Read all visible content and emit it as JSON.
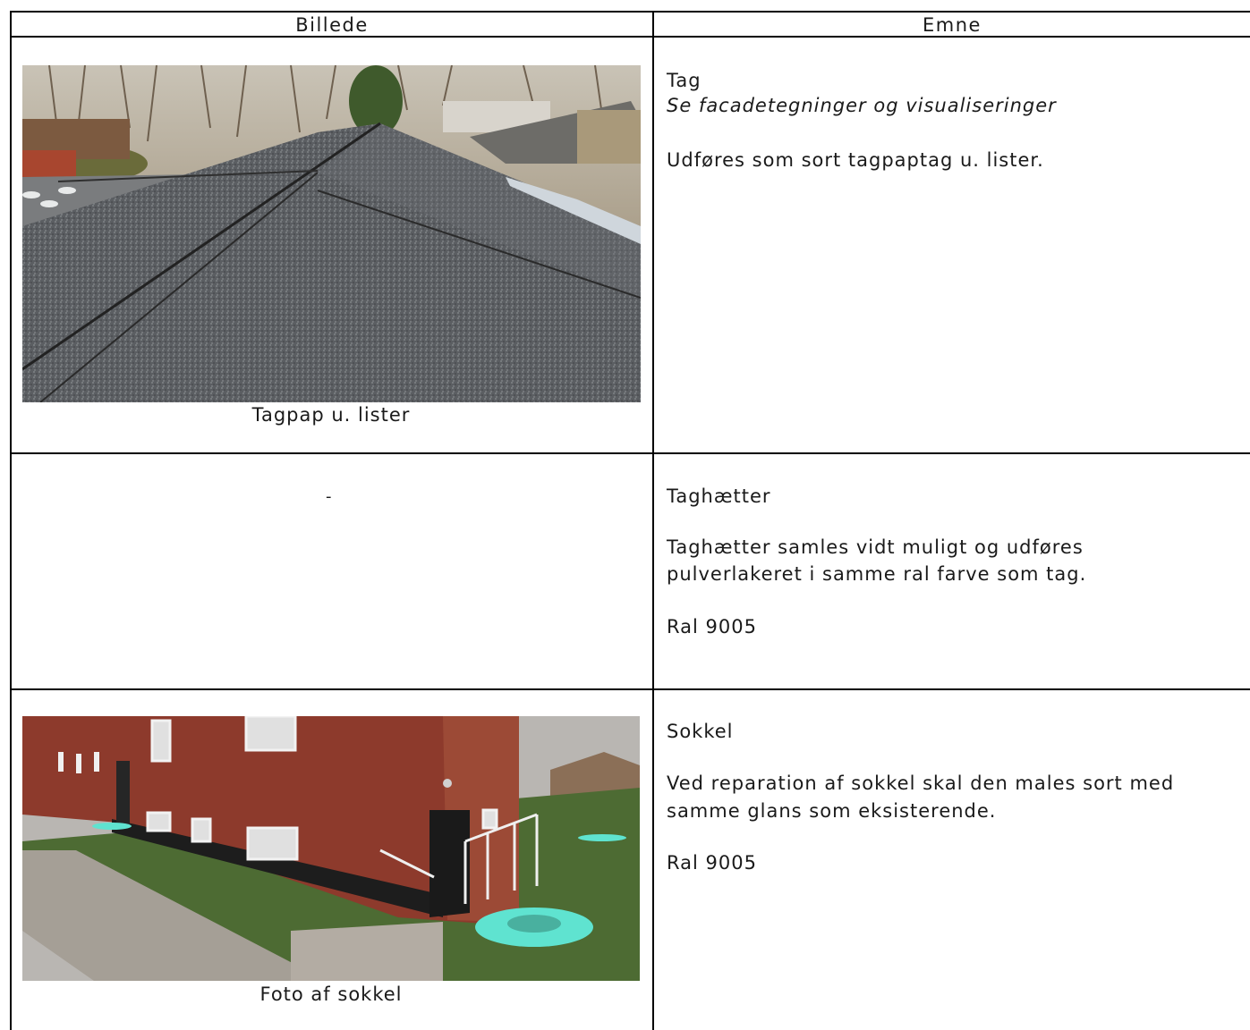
{
  "table": {
    "headers": {
      "image": "Billede",
      "subject": "Emne"
    },
    "rows": [
      {
        "image_caption": "Tagpap u. lister",
        "title": "Tag",
        "subtitle": "Se facadetegninger og visualiseringer",
        "body": [
          "Udføres som sort tagpaptag u. lister."
        ]
      },
      {
        "image_caption": "-",
        "title": "Taghætter",
        "body": [
          "Taghætter samles vidt muligt og udføres",
          "pulverlakeret i samme ral farve som tag."
        ],
        "ral": "Ral 9005"
      },
      {
        "image_caption": "Foto af sokkel",
        "title": "Sokkel",
        "body": [
          "Ved reparation af sokkel skal den males sort med",
          "samme glans som eksisterende."
        ],
        "ral": "Ral 9005"
      }
    ]
  },
  "colors": {
    "border": "#000000",
    "roof": "#55585c",
    "brick": "#8d3a2c",
    "marker": "#5fe3d0"
  }
}
